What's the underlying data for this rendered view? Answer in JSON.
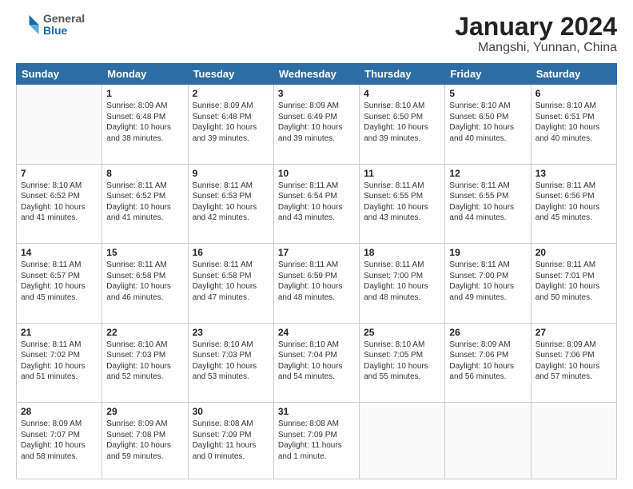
{
  "header": {
    "logo_general": "General",
    "logo_blue": "Blue",
    "title": "January 2024",
    "subtitle": "Mangshi, Yunnan, China"
  },
  "weekdays": [
    "Sunday",
    "Monday",
    "Tuesday",
    "Wednesday",
    "Thursday",
    "Friday",
    "Saturday"
  ],
  "weeks": [
    [
      {
        "day": "",
        "info": ""
      },
      {
        "day": "1",
        "info": "Sunrise: 8:09 AM\nSunset: 6:48 PM\nDaylight: 10 hours\nand 38 minutes."
      },
      {
        "day": "2",
        "info": "Sunrise: 8:09 AM\nSunset: 6:48 PM\nDaylight: 10 hours\nand 39 minutes."
      },
      {
        "day": "3",
        "info": "Sunrise: 8:09 AM\nSunset: 6:49 PM\nDaylight: 10 hours\nand 39 minutes."
      },
      {
        "day": "4",
        "info": "Sunrise: 8:10 AM\nSunset: 6:50 PM\nDaylight: 10 hours\nand 39 minutes."
      },
      {
        "day": "5",
        "info": "Sunrise: 8:10 AM\nSunset: 6:50 PM\nDaylight: 10 hours\nand 40 minutes."
      },
      {
        "day": "6",
        "info": "Sunrise: 8:10 AM\nSunset: 6:51 PM\nDaylight: 10 hours\nand 40 minutes."
      }
    ],
    [
      {
        "day": "7",
        "info": "Sunrise: 8:10 AM\nSunset: 6:52 PM\nDaylight: 10 hours\nand 41 minutes."
      },
      {
        "day": "8",
        "info": "Sunrise: 8:11 AM\nSunset: 6:52 PM\nDaylight: 10 hours\nand 41 minutes."
      },
      {
        "day": "9",
        "info": "Sunrise: 8:11 AM\nSunset: 6:53 PM\nDaylight: 10 hours\nand 42 minutes."
      },
      {
        "day": "10",
        "info": "Sunrise: 8:11 AM\nSunset: 6:54 PM\nDaylight: 10 hours\nand 43 minutes."
      },
      {
        "day": "11",
        "info": "Sunrise: 8:11 AM\nSunset: 6:55 PM\nDaylight: 10 hours\nand 43 minutes."
      },
      {
        "day": "12",
        "info": "Sunrise: 8:11 AM\nSunset: 6:55 PM\nDaylight: 10 hours\nand 44 minutes."
      },
      {
        "day": "13",
        "info": "Sunrise: 8:11 AM\nSunset: 6:56 PM\nDaylight: 10 hours\nand 45 minutes."
      }
    ],
    [
      {
        "day": "14",
        "info": "Sunrise: 8:11 AM\nSunset: 6:57 PM\nDaylight: 10 hours\nand 45 minutes."
      },
      {
        "day": "15",
        "info": "Sunrise: 8:11 AM\nSunset: 6:58 PM\nDaylight: 10 hours\nand 46 minutes."
      },
      {
        "day": "16",
        "info": "Sunrise: 8:11 AM\nSunset: 6:58 PM\nDaylight: 10 hours\nand 47 minutes."
      },
      {
        "day": "17",
        "info": "Sunrise: 8:11 AM\nSunset: 6:59 PM\nDaylight: 10 hours\nand 48 minutes."
      },
      {
        "day": "18",
        "info": "Sunrise: 8:11 AM\nSunset: 7:00 PM\nDaylight: 10 hours\nand 48 minutes."
      },
      {
        "day": "19",
        "info": "Sunrise: 8:11 AM\nSunset: 7:00 PM\nDaylight: 10 hours\nand 49 minutes."
      },
      {
        "day": "20",
        "info": "Sunrise: 8:11 AM\nSunset: 7:01 PM\nDaylight: 10 hours\nand 50 minutes."
      }
    ],
    [
      {
        "day": "21",
        "info": "Sunrise: 8:11 AM\nSunset: 7:02 PM\nDaylight: 10 hours\nand 51 minutes."
      },
      {
        "day": "22",
        "info": "Sunrise: 8:10 AM\nSunset: 7:03 PM\nDaylight: 10 hours\nand 52 minutes."
      },
      {
        "day": "23",
        "info": "Sunrise: 8:10 AM\nSunset: 7:03 PM\nDaylight: 10 hours\nand 53 minutes."
      },
      {
        "day": "24",
        "info": "Sunrise: 8:10 AM\nSunset: 7:04 PM\nDaylight: 10 hours\nand 54 minutes."
      },
      {
        "day": "25",
        "info": "Sunrise: 8:10 AM\nSunset: 7:05 PM\nDaylight: 10 hours\nand 55 minutes."
      },
      {
        "day": "26",
        "info": "Sunrise: 8:09 AM\nSunset: 7:06 PM\nDaylight: 10 hours\nand 56 minutes."
      },
      {
        "day": "27",
        "info": "Sunrise: 8:09 AM\nSunset: 7:06 PM\nDaylight: 10 hours\nand 57 minutes."
      }
    ],
    [
      {
        "day": "28",
        "info": "Sunrise: 8:09 AM\nSunset: 7:07 PM\nDaylight: 10 hours\nand 58 minutes."
      },
      {
        "day": "29",
        "info": "Sunrise: 8:09 AM\nSunset: 7:08 PM\nDaylight: 10 hours\nand 59 minutes."
      },
      {
        "day": "30",
        "info": "Sunrise: 8:08 AM\nSunset: 7:09 PM\nDaylight: 11 hours\nand 0 minutes."
      },
      {
        "day": "31",
        "info": "Sunrise: 8:08 AM\nSunset: 7:09 PM\nDaylight: 11 hours\nand 1 minute."
      },
      {
        "day": "",
        "info": ""
      },
      {
        "day": "",
        "info": ""
      },
      {
        "day": "",
        "info": ""
      }
    ]
  ]
}
